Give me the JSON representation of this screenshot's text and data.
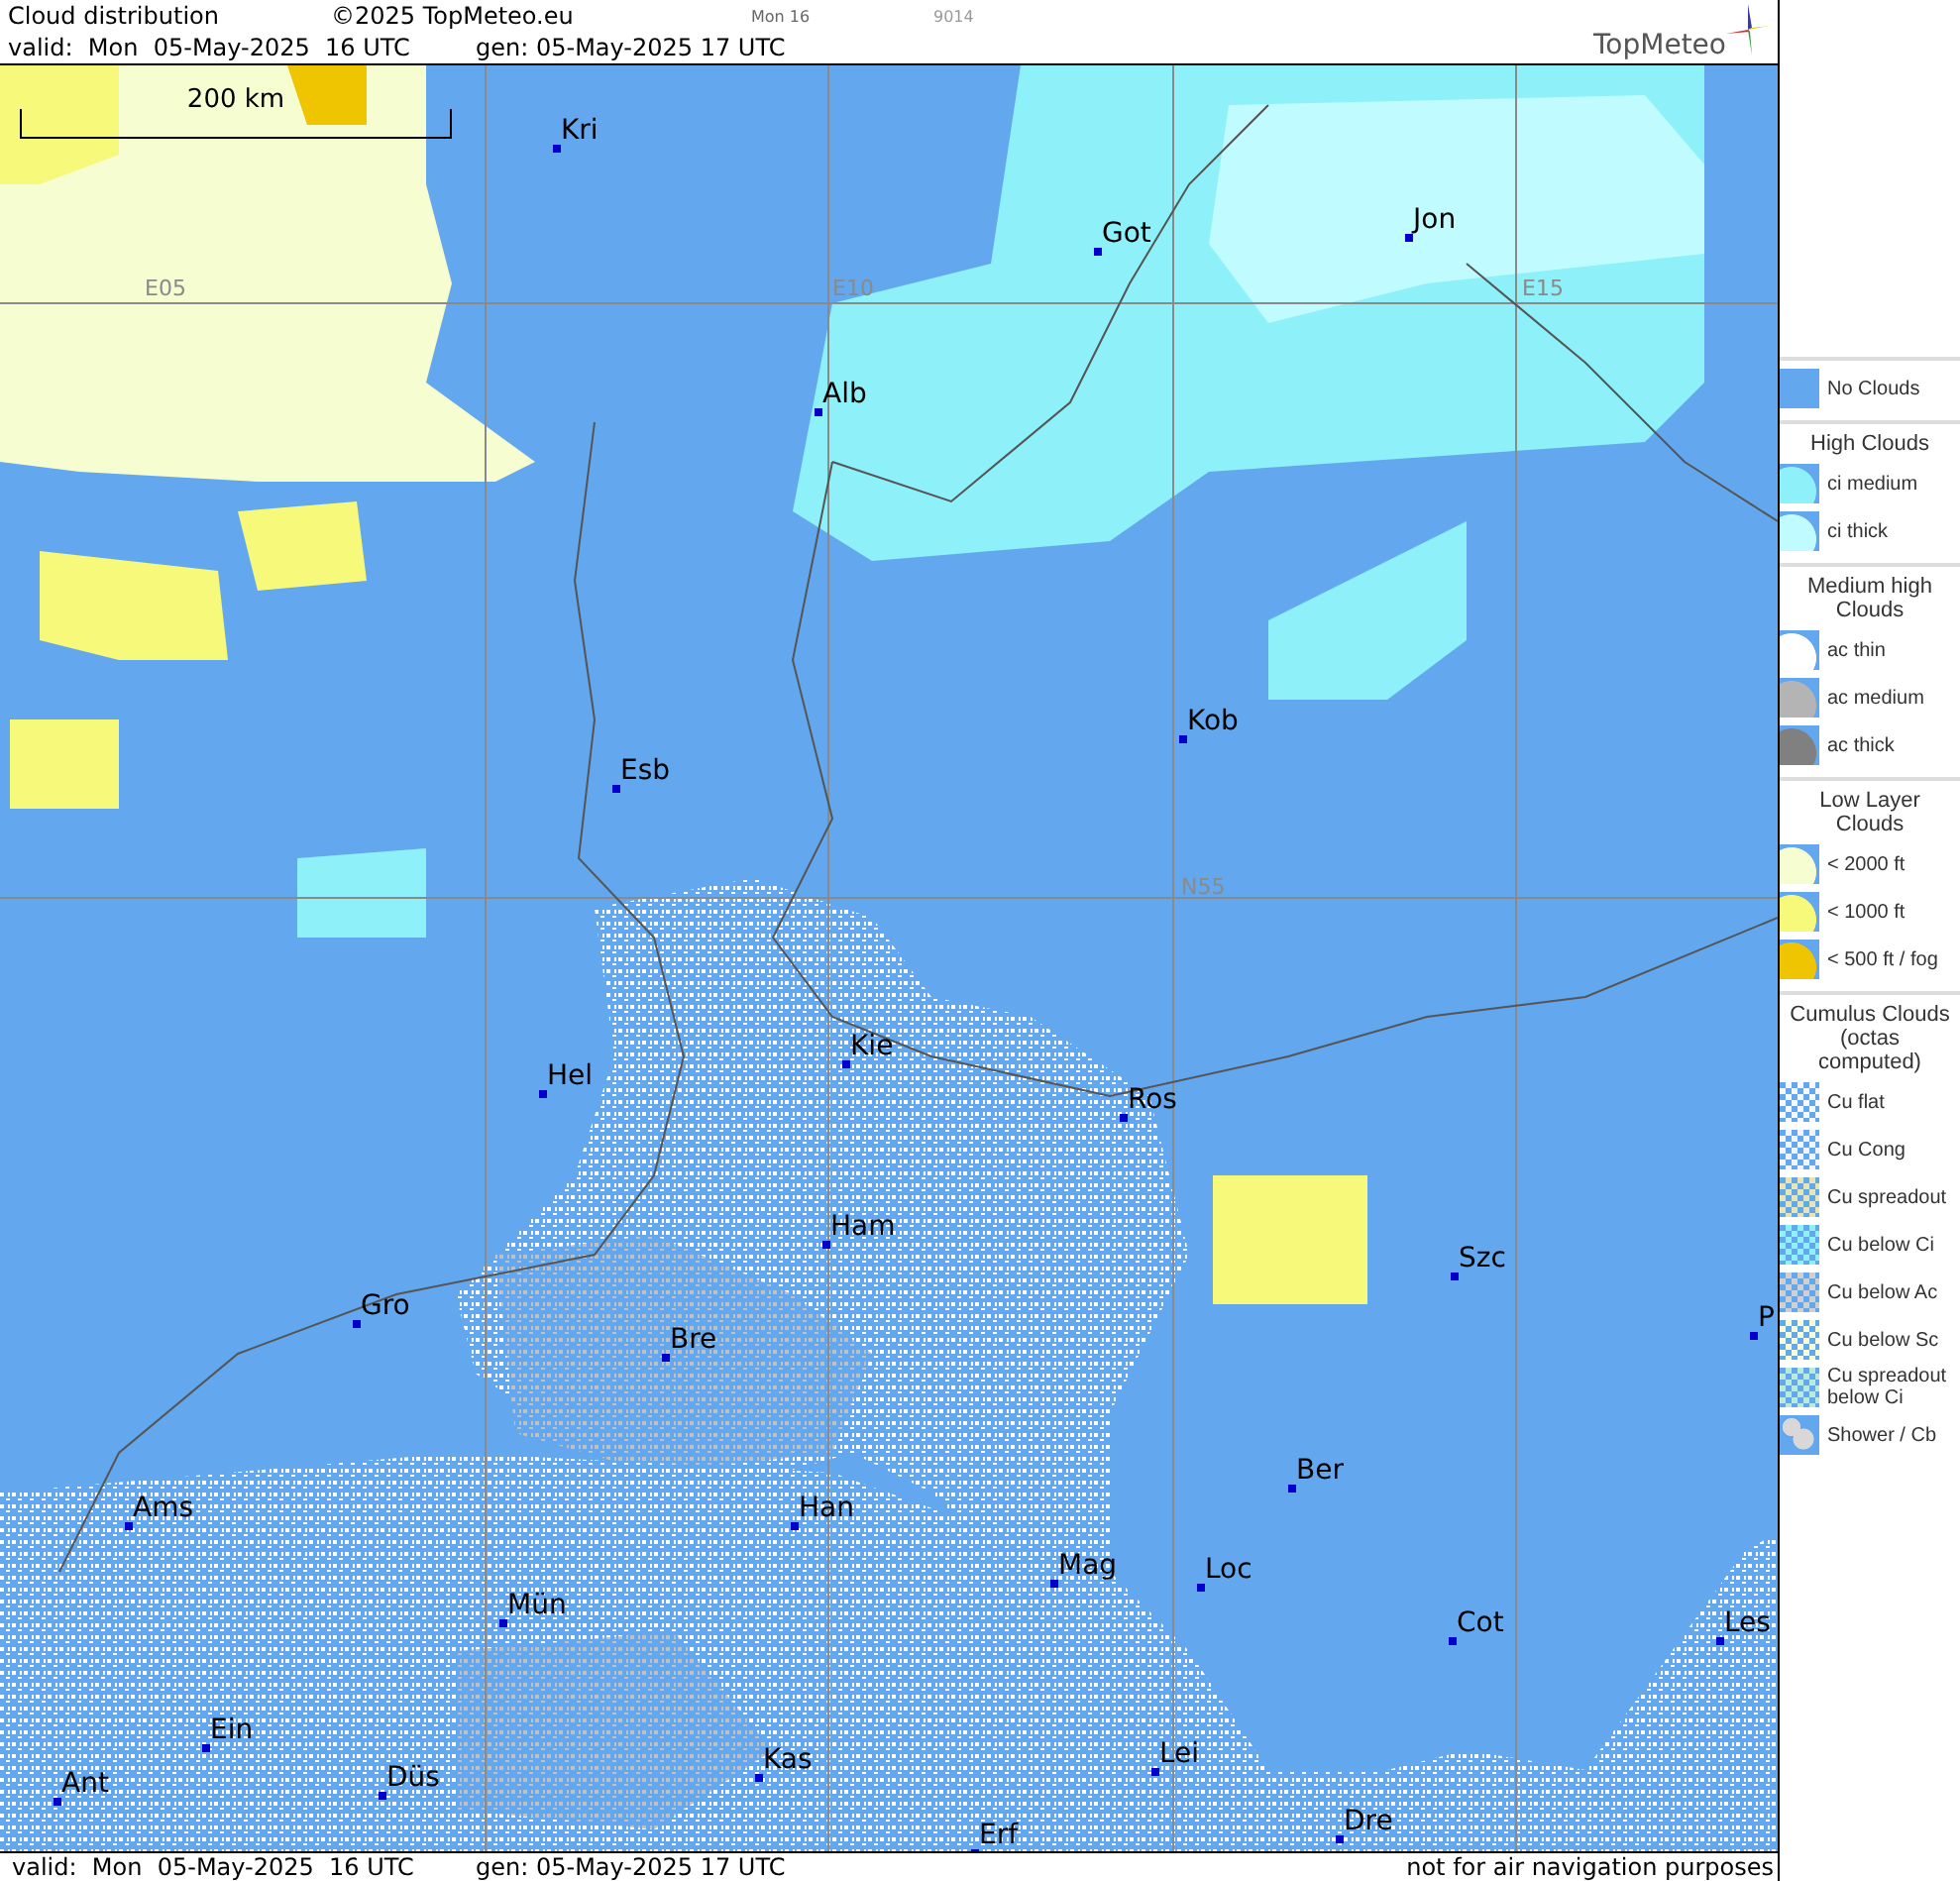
{
  "header": {
    "title": "Cloud distribution",
    "copyright": "©2025 TopMeteo.eu",
    "run": "Mon 16",
    "code": "9014",
    "valid": "valid:  Mon  05-May-2025  16 UTC",
    "generated": "gen: 05-May-2025 17 UTC",
    "logo": "TopMeteo"
  },
  "map": {
    "scale": "200 km",
    "grid_labels": [
      "E05",
      "E10",
      "E15",
      "N55"
    ],
    "cities": [
      "Kri",
      "Got",
      "Jon",
      "Alb",
      "Esb",
      "Kob",
      "Kie",
      "Hel",
      "Ros",
      "Ham",
      "Szc",
      "Gro",
      "Bre",
      "P",
      "Ber",
      "Ams",
      "Han",
      "Mag",
      "Loc",
      "Mün",
      "Cot",
      "Les",
      "Ein",
      "Kas",
      "Lei",
      "Ant",
      "Düs",
      "Dre",
      "Erf"
    ]
  },
  "legend": [
    {
      "items": [
        {
          "label": "No Clouds",
          "kind": "solid",
          "color": "#63a8ee"
        }
      ]
    },
    {
      "title": "High Clouds",
      "items": [
        {
          "label": "ci medium",
          "kind": "blob",
          "color": "#8ef0f8"
        },
        {
          "label": "ci thick",
          "kind": "blob",
          "color": "#c0fcff"
        }
      ]
    },
    {
      "title": "Medium high Clouds",
      "items": [
        {
          "label": "ac thin",
          "kind": "blob",
          "color": "#ffffff"
        },
        {
          "label": "ac medium",
          "kind": "blob",
          "color": "#b4b4b4"
        },
        {
          "label": "ac thick",
          "kind": "blob",
          "color": "#808080"
        }
      ]
    },
    {
      "title": "Low Layer Clouds",
      "items": [
        {
          "label": "< 2000 ft",
          "kind": "blob",
          "color": "#f6fdd0"
        },
        {
          "label": "< 1000 ft",
          "kind": "blob",
          "color": "#f6f97a"
        },
        {
          "label": "< 500 ft / fog",
          "kind": "blob",
          "color": "#efc400"
        }
      ]
    },
    {
      "title": "Cumulus Clouds (octas computed)",
      "items": [
        {
          "label": "Cu flat",
          "kind": "speckled",
          "color": "#f4f8ff"
        },
        {
          "label": "Cu Cong",
          "kind": "speckled",
          "color": "#f0f4ff"
        },
        {
          "label": "Cu spreadout",
          "kind": "speckled",
          "color": "#e8e6b0"
        },
        {
          "label": "Cu below Ci",
          "kind": "speckled",
          "color": "#8ef0f8"
        },
        {
          "label": "Cu below Ac",
          "kind": "speckled",
          "color": "#d0d0d0"
        },
        {
          "label": "Cu below Sc",
          "kind": "speckled",
          "color": "#f6fdd0"
        },
        {
          "label": "Cu spreadout below Ci",
          "kind": "speckled",
          "color": "#b8ecd8"
        },
        {
          "label": "Shower / Cb",
          "kind": "shower",
          "color": "#d8d8d8"
        }
      ]
    }
  ],
  "footer": {
    "valid": "valid:  Mon  05-May-2025  16 UTC",
    "generated": "gen: 05-May-2025 17 UTC",
    "note": "not for air navigation purposes"
  }
}
